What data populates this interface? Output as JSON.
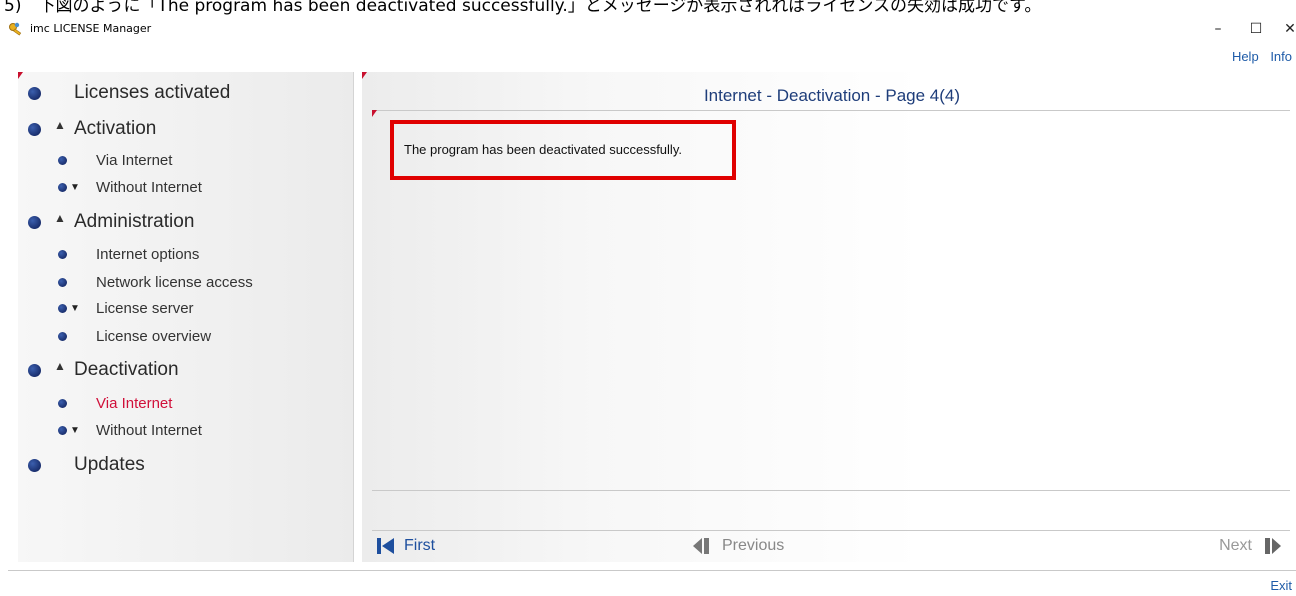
{
  "caption": "5)　下図のように「The program has been deactivated successfully.」とメッセージが表示されればライセンスの失効は成功です。",
  "window": {
    "title": "imc LICENSE Manager",
    "minimize": "–",
    "maximize": "☐",
    "close": "✕"
  },
  "menu": {
    "help": "Help",
    "info": "Info"
  },
  "sidebar": {
    "licenses_activated": "Licenses activated",
    "activation": "Activation",
    "activation_via_internet": "Via Internet",
    "activation_without_internet": "Without Internet",
    "administration": "Administration",
    "internet_options": "Internet options",
    "network_license_access": "Network license access",
    "license_server": "License server",
    "license_overview": "License overview",
    "deactivation": "Deactivation",
    "deactivation_via_internet": "Via Internet",
    "deactivation_without_internet": "Without Internet",
    "updates": "Updates",
    "active_item": "deactivation_via_internet"
  },
  "main": {
    "title": "Internet - Deactivation - Page 4(4)",
    "message": "The program has been deactivated successfully."
  },
  "navigation": {
    "first": "First",
    "previous": "Previous",
    "next": "Next"
  },
  "footer": {
    "exit": "Exit"
  },
  "colors": {
    "accent_blue": "#1e5ba8",
    "active_item": "#d0103a",
    "highlight_box": "#e00000",
    "title_blue": "#1e3d7a"
  }
}
